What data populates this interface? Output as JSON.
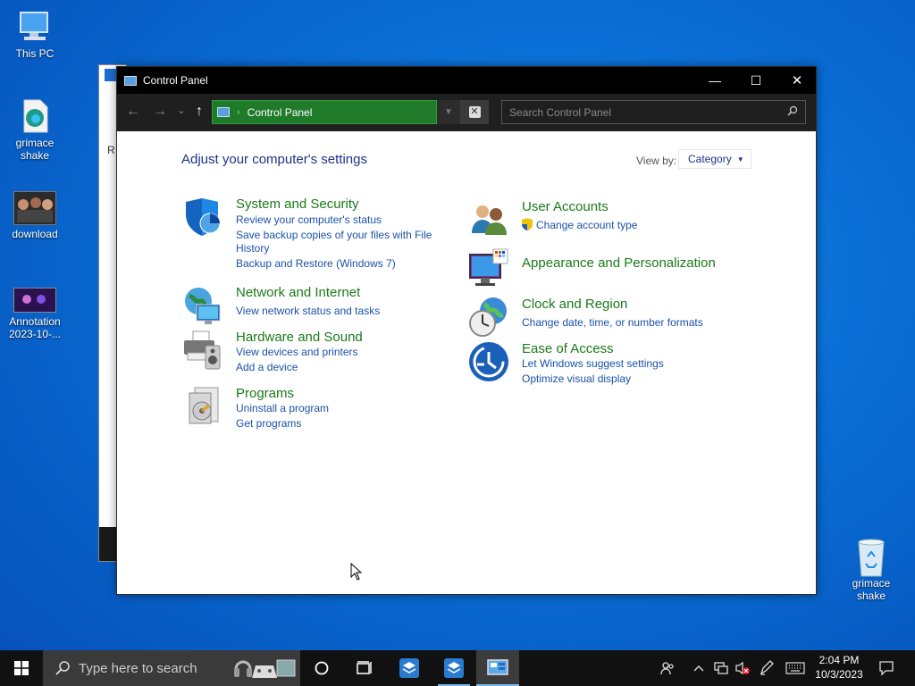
{
  "desktop": {
    "icons": [
      {
        "label": "This PC"
      },
      {
        "label": "grimace shake"
      },
      {
        "label": "download"
      },
      {
        "label": "Annotation 2023-10-..."
      },
      {
        "label": "grimace shake"
      }
    ],
    "bg_window_fragment": "R"
  },
  "window": {
    "title": "Control Panel",
    "minimize": "—",
    "maximize": "☐",
    "close": "✕"
  },
  "navbar": {
    "back": "←",
    "forward": "→",
    "recent": "⌄",
    "up": "↑",
    "address_separator": "›",
    "address": "Control Panel",
    "search_placeholder": "Search Control Panel"
  },
  "content": {
    "heading": "Adjust your computer's settings",
    "view_by_label": "View by:",
    "view_by_value": "Category",
    "left_categories": [
      {
        "title": "System and Security",
        "links": [
          "Review your computer's status",
          "Save backup copies of your files with File",
          "History",
          "Backup and Restore (Windows 7)"
        ]
      },
      {
        "title": "Network and Internet",
        "links": [
          "View network status and tasks"
        ]
      },
      {
        "title": "Hardware and Sound",
        "links": [
          "View devices and printers",
          "Add a device"
        ]
      },
      {
        "title": "Programs",
        "links": [
          "Uninstall a program",
          "Get programs"
        ]
      }
    ],
    "right_categories": [
      {
        "title": "User Accounts",
        "links": [
          "Change account type"
        ]
      },
      {
        "title": "Appearance and Personalization",
        "links": []
      },
      {
        "title": "Clock and Region",
        "links": [
          "Change date, time, or number formats"
        ]
      },
      {
        "title": "Ease of Access",
        "links": [
          "Let Windows suggest settings",
          "Optimize visual display"
        ]
      }
    ]
  },
  "taskbar": {
    "search_placeholder": "Type here to search",
    "clock_time": "2:04 PM",
    "clock_date": "10/3/2023"
  },
  "colors": {
    "address_bg": "#1f7a2a",
    "category_title": "#1a7a1a",
    "link": "#1a52a8",
    "heading": "#1e3287"
  }
}
